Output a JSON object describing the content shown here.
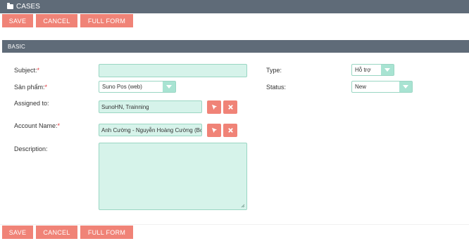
{
  "window": {
    "title": "CASES",
    "icon": "folder-icon"
  },
  "toolbar_top": {
    "save": "SAVE",
    "cancel": "CANCEL",
    "full_form": "FULL FORM"
  },
  "section": {
    "title": "BASIC"
  },
  "form": {
    "subject": {
      "label": "Subject:",
      "required": "*",
      "value": ""
    },
    "san_pham": {
      "label": "Sản phẩm:",
      "required": "*",
      "value": "Suno Pos (web)"
    },
    "assigned_to": {
      "label": "Assigned to:",
      "value": "SunoHN, Trainning"
    },
    "account_name": {
      "label": "Account Name:",
      "required": "*",
      "value": "Anh Cường - Nguyễn Hoàng Cường (Bơ"
    },
    "description": {
      "label": "Description:",
      "value": ""
    },
    "type": {
      "label": "Type:",
      "value": "Hỗ trợ"
    },
    "status": {
      "label": "Status:",
      "value": "New"
    }
  },
  "toolbar_bottom": {
    "save": "SAVE",
    "cancel": "CANCEL",
    "full_form": "FULL FORM"
  },
  "colors": {
    "header": "#5f6b78",
    "button": "#f08377",
    "field_bg": "#d6f3ea",
    "field_border": "#9ad6c3",
    "required": "#e0353a"
  },
  "icons": {
    "select": "cursor-select-icon",
    "clear": "close-icon",
    "resize": "resize-grip-icon"
  }
}
